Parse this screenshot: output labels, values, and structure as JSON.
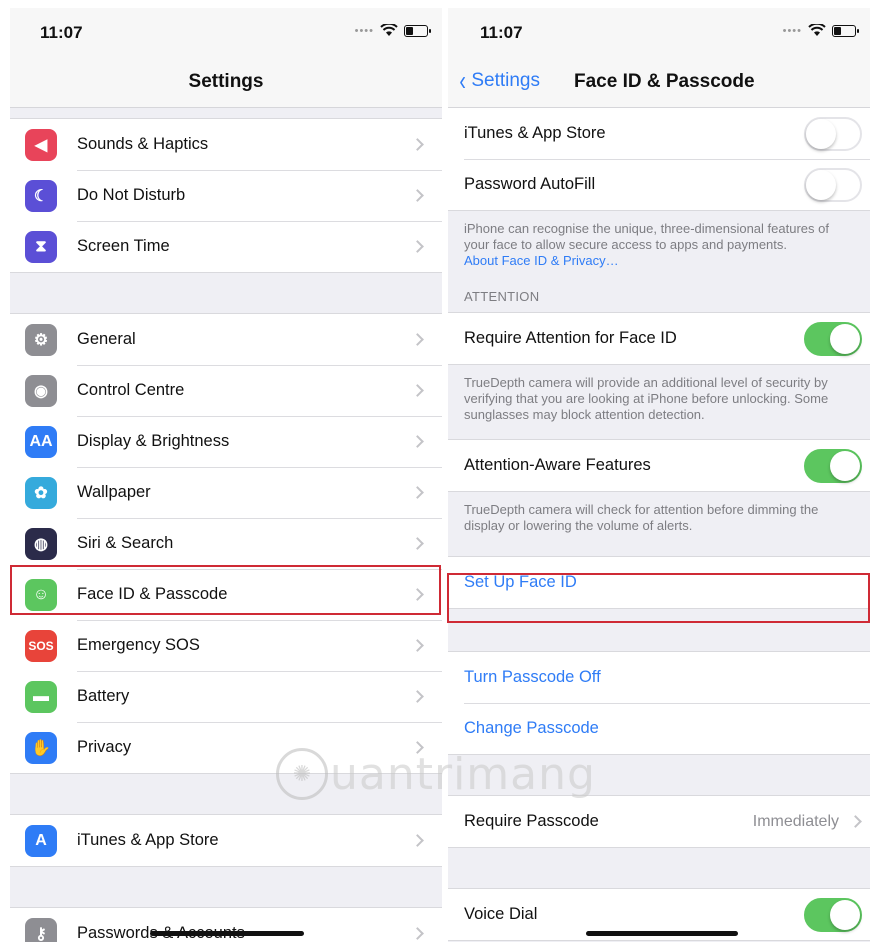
{
  "left": {
    "status": {
      "time": "11:07"
    },
    "title": "Settings",
    "groups": [
      [
        {
          "label": "Sounds & Haptics",
          "icon": "speaker-icon",
          "color": "#e8445a",
          "glyph": "◀︎"
        },
        {
          "label": "Do Not Disturb",
          "icon": "moon-icon",
          "color": "#5b4fd6",
          "glyph": "☾"
        },
        {
          "label": "Screen Time",
          "icon": "hourglass-icon",
          "color": "#5b4fd6",
          "glyph": "⧗"
        }
      ],
      [
        {
          "label": "General",
          "icon": "gear-icon",
          "color": "#8e8e93",
          "glyph": "⚙"
        },
        {
          "label": "Control Centre",
          "icon": "toggles-icon",
          "color": "#8e8e93",
          "glyph": "◉"
        },
        {
          "label": "Display & Brightness",
          "icon": "text-size-icon",
          "color": "#2f7cf6",
          "glyph": "AA"
        },
        {
          "label": "Wallpaper",
          "icon": "flower-icon",
          "color": "#35aadc",
          "glyph": "✿"
        },
        {
          "label": "Siri & Search",
          "icon": "siri-icon",
          "color": "#2b2b4a",
          "glyph": "◍"
        },
        {
          "label": "Face ID & Passcode",
          "icon": "face-id-icon",
          "color": "#5cc65f",
          "glyph": "☺"
        },
        {
          "label": "Emergency SOS",
          "icon": "sos-icon",
          "color": "#e8443a",
          "glyph": "SOS"
        },
        {
          "label": "Battery",
          "icon": "battery-icon",
          "color": "#5cc65f",
          "glyph": "▬"
        },
        {
          "label": "Privacy",
          "icon": "hand-icon",
          "color": "#2f7cf6",
          "glyph": "✋"
        }
      ],
      [
        {
          "label": "iTunes & App Store",
          "icon": "app-store-icon",
          "color": "#2f7cf6",
          "glyph": "A"
        }
      ],
      [
        {
          "label": "Passwords & Accounts",
          "icon": "key-icon",
          "color": "#8e8e93",
          "glyph": "⚷"
        }
      ]
    ]
  },
  "right": {
    "status": {
      "time": "11:07"
    },
    "back_label": "Settings",
    "title": "Face ID & Passcode",
    "itunes_label": "iTunes & App Store",
    "itunes_on": false,
    "autofill_label": "Password AutoFill",
    "autofill_on": false,
    "faceid_footer": "iPhone can recognise the unique, three-dimensional features of your face to allow secure access to apps and payments.",
    "faceid_footer_link": "About Face ID & Privacy…",
    "attention_header": "ATTENTION",
    "require_attention_label": "Require Attention for Face ID",
    "require_attention_on": true,
    "require_attention_footer": "TrueDepth camera will provide an additional level of security by verifying that you are looking at iPhone before unlocking. Some sunglasses may block attention detection.",
    "attention_aware_label": "Attention-Aware Features",
    "attention_aware_on": true,
    "attention_aware_footer": "TrueDepth camera will check for attention before dimming the display or lowering the volume of alerts.",
    "setup_label": "Set Up Face ID",
    "turn_off_label": "Turn Passcode Off",
    "change_label": "Change Passcode",
    "require_passcode_label": "Require Passcode",
    "require_passcode_value": "Immediately",
    "voice_dial_label": "Voice Dial",
    "voice_dial_on": true
  },
  "colors": {
    "accent": "#2f7cf6",
    "toggle_on": "#5cc65f",
    "highlight": "#cf2a35"
  }
}
